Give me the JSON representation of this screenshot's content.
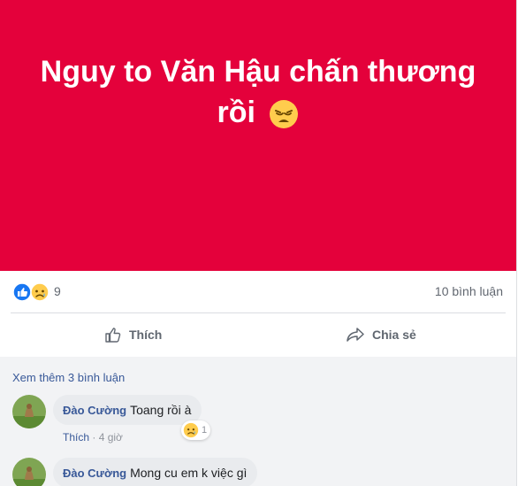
{
  "post": {
    "banner_text_line1": "Nguy to Văn Hậu chấn thương",
    "banner_text_line2": "rồi",
    "banner_emoji": "weary-face-emoji",
    "banner_color": "#e4013b"
  },
  "reactions": {
    "icons": [
      "like-icon",
      "sad-icon"
    ],
    "count": "9",
    "comments_label": "10 bình luận"
  },
  "actions": {
    "like_label": "Thích",
    "share_label": "Chia sẻ"
  },
  "comments": {
    "see_more": "Xem thêm 3 bình luận",
    "items": [
      {
        "author": "Đào Cường",
        "text": "Toang rồi à",
        "like_label": "Thích",
        "time": "4 giờ",
        "reaction_count": "1"
      },
      {
        "author": "Đào Cường",
        "text": "Mong cu em k việc gì"
      }
    ]
  },
  "colors": {
    "link": "#385898",
    "muted": "#616770",
    "comment_bg": "#f2f3f5",
    "bubble_bg": "#e9ebee"
  }
}
